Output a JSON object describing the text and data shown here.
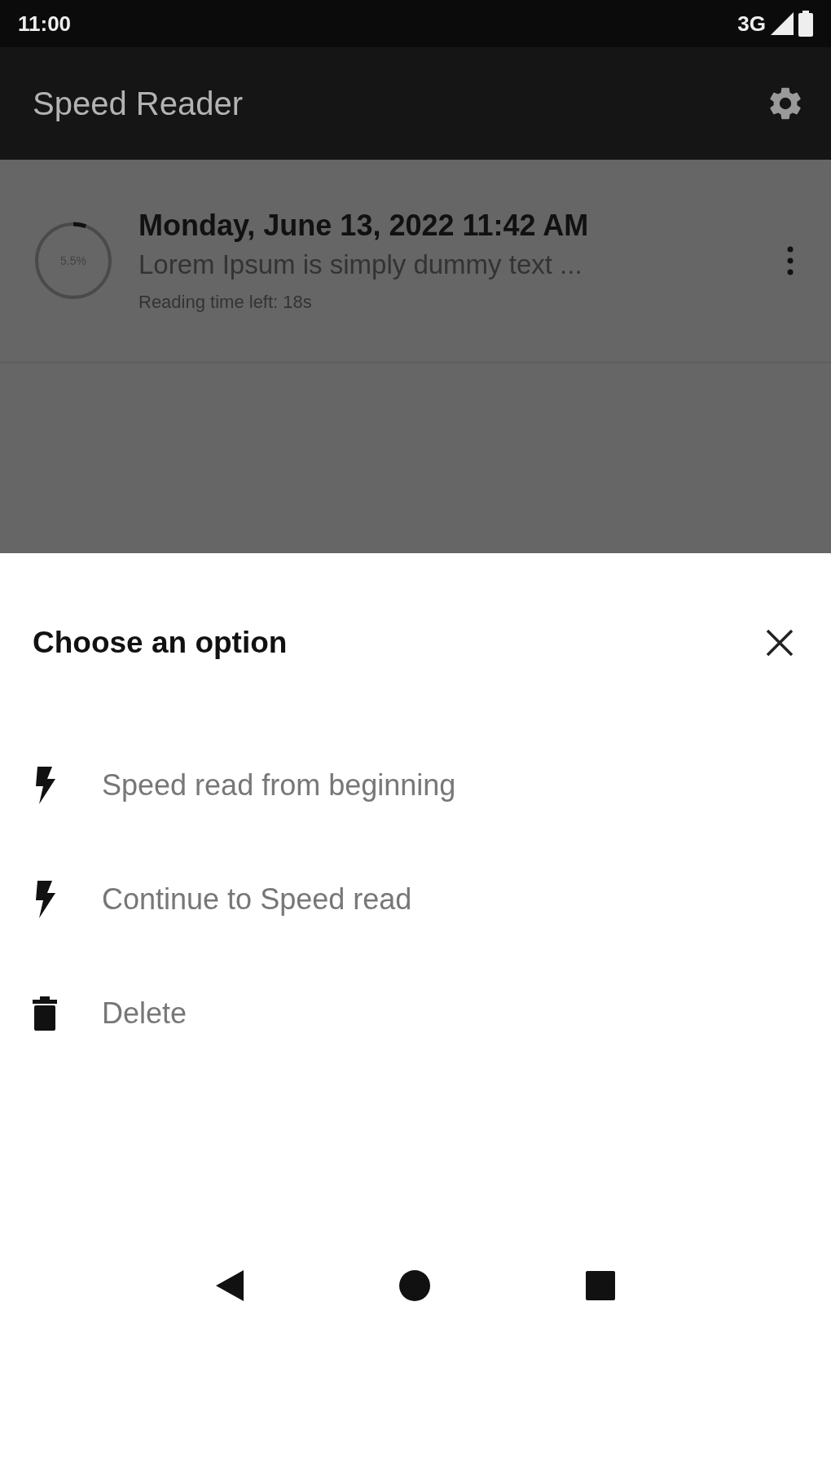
{
  "status_bar": {
    "time": "11:00",
    "network": "3G"
  },
  "app_bar": {
    "title": "Speed Reader"
  },
  "documents": [
    {
      "title": "Monday, June 13, 2022 11:42 AM",
      "preview": "Lorem Ipsum is simply dummy text ...",
      "progress_label": "5.5%",
      "level": 0.055,
      "reading_time": "Reading time left: 18s"
    }
  ],
  "sheet": {
    "title": "Choose an option",
    "options": [
      {
        "kind": "bolt",
        "label": "Speed read from beginning"
      },
      {
        "kind": "bolt",
        "label": "Continue to Speed read"
      },
      {
        "kind": "trash",
        "label": "Delete"
      }
    ]
  }
}
